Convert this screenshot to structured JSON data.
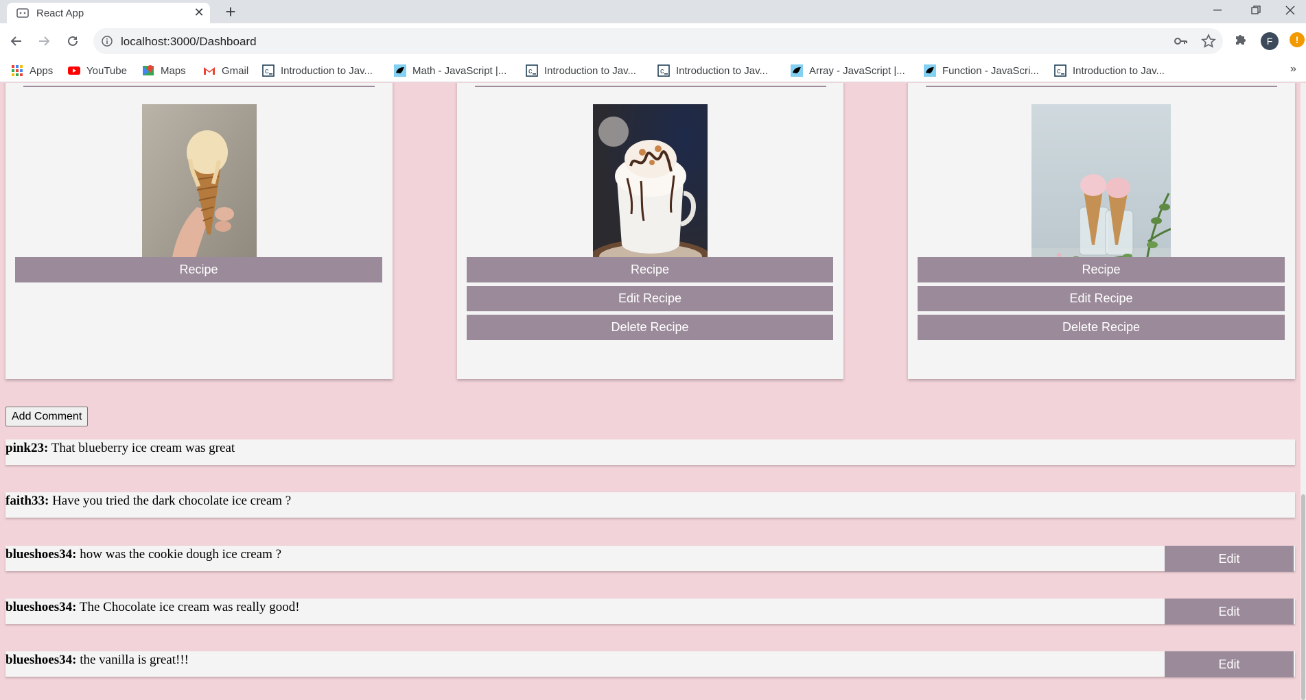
{
  "browser": {
    "tab_title": "React App",
    "url": "localhost:3000/Dashboard",
    "profile_initial": "F",
    "bookmarks": [
      {
        "label": "Apps",
        "icon": "apps-grid-icon"
      },
      {
        "label": "YouTube",
        "icon": "youtube-icon"
      },
      {
        "label": "Maps",
        "icon": "maps-icon"
      },
      {
        "label": "Gmail",
        "icon": "gmail-icon"
      },
      {
        "label": "Introduction to Jav...",
        "icon": "codecademy-icon"
      },
      {
        "label": "Math - JavaScript |...",
        "icon": "mdn-icon"
      },
      {
        "label": "Introduction to Jav...",
        "icon": "codecademy-icon"
      },
      {
        "label": "Introduction to Jav...",
        "icon": "codecademy-icon"
      },
      {
        "label": "Array - JavaScript |...",
        "icon": "mdn-icon"
      },
      {
        "label": "Function - JavaScri...",
        "icon": "mdn-icon"
      },
      {
        "label": "Introduction to Jav...",
        "icon": "codecademy-icon"
      }
    ],
    "bookmarks_more": "»"
  },
  "cards": [
    {
      "image_alt": "hand holding melting vanilla ice cream cone",
      "buttons": {
        "recipe": "Recipe"
      }
    },
    {
      "image_alt": "white cup of hot chocolate with whipped cream and chocolate drizzle",
      "buttons": {
        "recipe": "Recipe",
        "edit": "Edit Recipe",
        "delete": "Delete Recipe"
      }
    },
    {
      "image_alt": "two strawberry ice cream cones in glass jars with greenery",
      "buttons": {
        "recipe": "Recipe",
        "edit": "Edit Recipe",
        "delete": "Delete Recipe"
      }
    }
  ],
  "add_comment_label": "Add Comment",
  "comments": [
    {
      "user": "pink23:",
      "text": " That blueberry ice cream was great"
    },
    {
      "user": "faith33:",
      "text": " Have you tried the dark chocolate ice cream ?"
    },
    {
      "user": "blueshoes34:",
      "text": " how was the cookie dough ice cream ?",
      "edit": "Edit"
    },
    {
      "user": "blueshoes34:",
      "text": " The Chocolate ice cream was really good!",
      "edit": "Edit"
    },
    {
      "user": "blueshoes34:",
      "text": " the vanilla is great!!!",
      "edit": "Edit"
    }
  ],
  "colors": {
    "page_background": "#f2d3d9",
    "card_background": "#f4f4f4",
    "button_mauve": "#9b8b9a",
    "button_text": "#ffffff"
  }
}
